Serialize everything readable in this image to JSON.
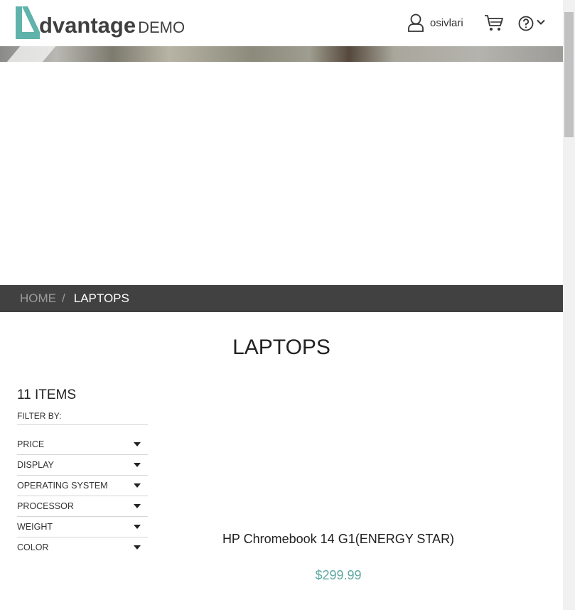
{
  "header": {
    "logo_text": "dvantage",
    "logo_demo": "DEMO",
    "username": "osivlari",
    "icons": [
      "user-icon",
      "cart-icon",
      "help-icon",
      "chevron-down-icon"
    ]
  },
  "breadcrumb": {
    "home": "HOME",
    "separator": "/",
    "current": "LAPTOPS"
  },
  "page_title": "LAPTOPS",
  "filters": {
    "items_count": "11 ITEMS",
    "filter_by": "FILTER BY:",
    "items": [
      {
        "label": "PRICE"
      },
      {
        "label": "DISPLAY"
      },
      {
        "label": "OPERATING SYSTEM"
      },
      {
        "label": "PROCESSOR"
      },
      {
        "label": "WEIGHT"
      },
      {
        "label": "COLOR"
      }
    ]
  },
  "product": {
    "name": "HP Chromebook 14 G1(ENERGY STAR)",
    "price": "$299.99"
  },
  "colors": {
    "accent": "#5fa8a3",
    "breadcrumb_bg": "#414141",
    "logo_mark": "#5fb3aa"
  }
}
